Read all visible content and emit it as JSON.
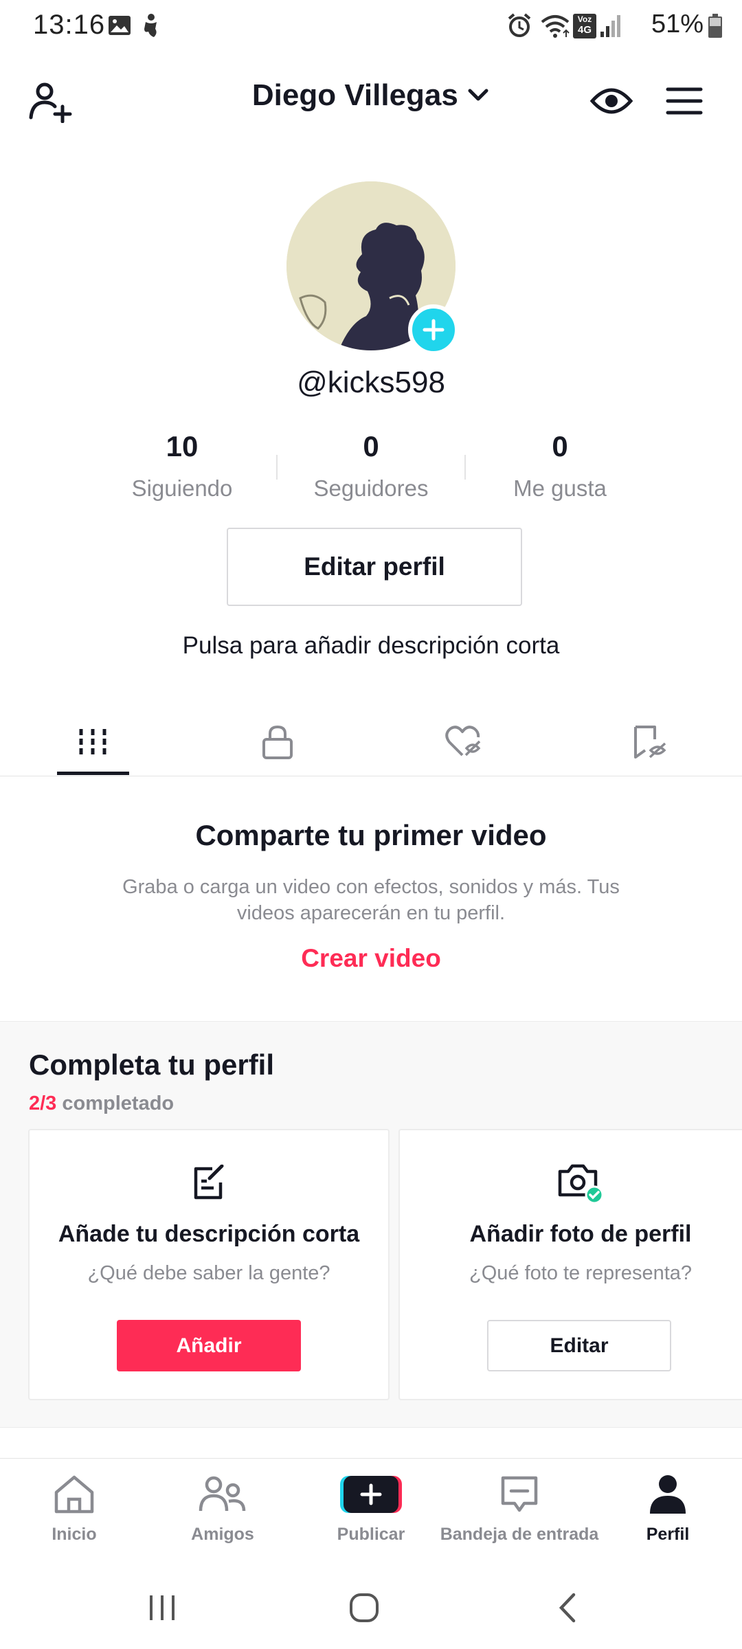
{
  "status_bar": {
    "time": "13:16",
    "battery": "51%",
    "icons": [
      "gallery-icon",
      "accessibility-icon",
      "alarm-icon",
      "wifi-icon",
      "volte-4g-icon",
      "signal-icon",
      "battery-icon"
    ],
    "volte_label": "Voz",
    "network_label": "4G"
  },
  "header": {
    "add_friend_icon": "person-add-icon",
    "username": "Diego Villegas",
    "dropdown_icon": "chevron-down-icon",
    "view_icon": "eye-icon",
    "menu_icon": "hamburger-menu-icon"
  },
  "profile": {
    "handle": "@kicks598",
    "avatar_add_icon": "plus-icon",
    "stats": [
      {
        "value": "10",
        "label": "Siguiendo"
      },
      {
        "value": "0",
        "label": "Seguidores"
      },
      {
        "value": "0",
        "label": "Me gusta"
      }
    ],
    "edit_button": "Editar perfil",
    "bio_hint": "Pulsa para añadir descripción corta"
  },
  "tabs": [
    {
      "name": "videos",
      "icon": "grid-icon",
      "active": true
    },
    {
      "name": "private",
      "icon": "lock-icon",
      "active": false
    },
    {
      "name": "liked",
      "icon": "heart-hidden-icon",
      "active": false
    },
    {
      "name": "saved",
      "icon": "bookmark-hidden-icon",
      "active": false
    }
  ],
  "empty_state": {
    "title": "Comparte tu primer video",
    "description": "Graba o carga un video con efectos, sonidos y más. Tus videos aparecerán en tu perfil.",
    "cta": "Crear video"
  },
  "complete_profile": {
    "title": "Completa tu perfil",
    "progress_fraction": "2/3",
    "progress_label": "completado",
    "cards": [
      {
        "icon": "edit-note-icon",
        "title": "Añade tu descripción corta",
        "subtitle": "¿Qué debe saber la gente?",
        "button": "Añadir"
      },
      {
        "icon": "camera-check-icon",
        "title": "Añadir foto de perfil",
        "subtitle": "¿Qué foto te representa?",
        "button": "Editar"
      }
    ]
  },
  "bottom_nav": [
    {
      "label": "Inicio",
      "icon": "home-icon"
    },
    {
      "label": "Amigos",
      "icon": "friends-icon"
    },
    {
      "label": "Publicar",
      "icon": "create-plus-icon"
    },
    {
      "label": "Bandeja de entrada",
      "icon": "inbox-icon"
    },
    {
      "label": "Perfil",
      "icon": "profile-icon",
      "active": true
    }
  ],
  "system_nav": [
    "recents-icon",
    "home-circle-icon",
    "back-icon"
  ],
  "colors": {
    "accent": "#fe2c55",
    "cyan": "#20d5ec",
    "text_primary": "#161823",
    "text_secondary": "#8a8b91"
  }
}
